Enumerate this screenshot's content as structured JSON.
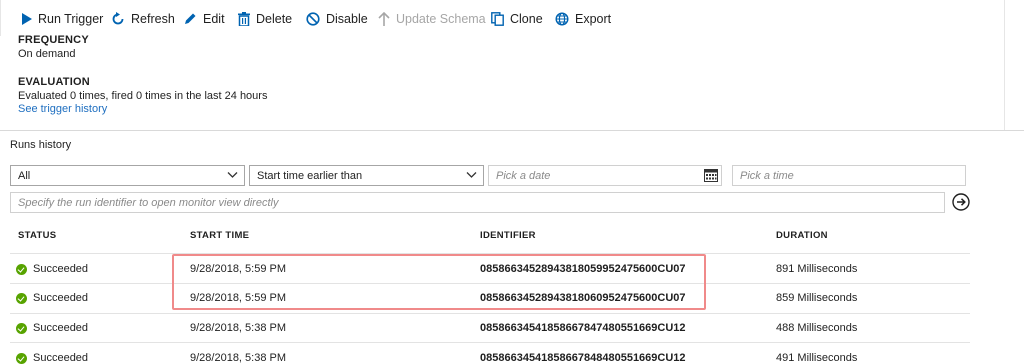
{
  "toolbar": {
    "run_trigger": "Run Trigger",
    "refresh": "Refresh",
    "edit": "Edit",
    "delete": "Delete",
    "disable": "Disable",
    "update_schema": "Update Schema",
    "clone": "Clone",
    "export": "Export"
  },
  "frequency": {
    "title": "FREQUENCY",
    "value": "On demand"
  },
  "evaluation": {
    "title": "EVALUATION",
    "text": "Evaluated 0 times, fired 0 times in the last 24 hours",
    "link": "See trigger history"
  },
  "runs": {
    "title": "Runs history",
    "status_filter": "All",
    "time_filter": "Start time earlier than",
    "date_placeholder": "Pick a date",
    "time_placeholder": "Pick a time",
    "identifier_placeholder": "Specify the run identifier to open monitor view directly",
    "columns": {
      "status": "STATUS",
      "start_time": "START TIME",
      "identifier": "IDENTIFIER",
      "duration": "DURATION"
    },
    "rows": [
      {
        "status": "Succeeded",
        "start_time": "9/28/2018, 5:59 PM",
        "identifier": "08586634528943818059952475600CU07",
        "duration": "891 Milliseconds"
      },
      {
        "status": "Succeeded",
        "start_time": "9/28/2018, 5:59 PM",
        "identifier": "08586634528943818060952475600CU07",
        "duration": "859 Milliseconds"
      },
      {
        "status": "Succeeded",
        "start_time": "9/28/2018, 5:38 PM",
        "identifier": "08586634541858667847480551669CU12",
        "duration": "488 Milliseconds"
      },
      {
        "status": "Succeeded",
        "start_time": "9/28/2018, 5:38 PM",
        "identifier": "08586634541858667848480551669CU12",
        "duration": "491 Milliseconds"
      }
    ]
  },
  "colors": {
    "accent": "#0063b1",
    "link": "#1f6fc0",
    "success": "#57a300",
    "highlight": "#f08a8a"
  }
}
